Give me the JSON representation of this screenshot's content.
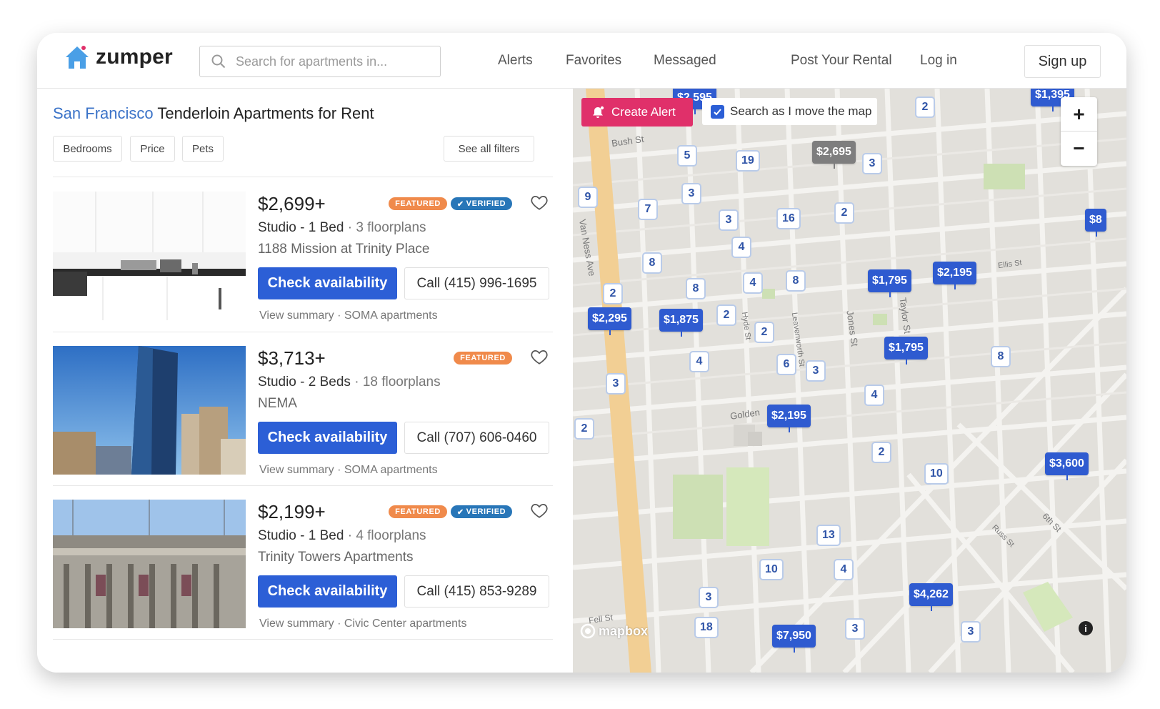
{
  "brand": {
    "name": "zumper"
  },
  "search": {
    "placeholder": "Search for apartments in..."
  },
  "nav": {
    "alerts": "Alerts",
    "favorites": "Favorites",
    "messaged": "Messaged",
    "post": "Post Your Rental",
    "login": "Log in",
    "signup": "Sign up"
  },
  "page": {
    "city": "San Francisco",
    "title_rest": " Tenderloin Apartments for Rent"
  },
  "filters": {
    "bedrooms": "Bedrooms",
    "price": "Price",
    "pets": "Pets",
    "all": "See all filters"
  },
  "badges": {
    "featured": "FEATURED",
    "verified": "VERIFIED"
  },
  "listings": [
    {
      "price": "$2,699+",
      "beds": "Studio - 1 Bed",
      "sep": " · ",
      "floorplans": "3 floorplans",
      "name": "1188 Mission at Trinity Place",
      "cta": "Check availability",
      "call": "Call (415) 996-1695",
      "view": "View summary",
      "dot": " · ",
      "area": "SOMA apartments",
      "featured": true,
      "verified": true
    },
    {
      "price": "$3,713+",
      "beds": "Studio - 2 Beds",
      "sep": " · ",
      "floorplans": "18 floorplans",
      "name": "NEMA",
      "cta": "Check availability",
      "call": "Call (707) 606-0460",
      "view": "View summary",
      "dot": " · ",
      "area": "SOMA apartments",
      "featured": true,
      "verified": false
    },
    {
      "price": "$2,199+",
      "beds": "Studio - 1 Bed",
      "sep": " · ",
      "floorplans": "4 floorplans",
      "name": "Trinity Towers Apartments",
      "cta": "Check availability",
      "call": "Call (415) 853-9289",
      "view": "View summary",
      "dot": " · ",
      "area": "Civic Center apartments",
      "featured": true,
      "verified": true
    }
  ],
  "map": {
    "create_alert": "Create Alert",
    "search_move": "Search as I move the map",
    "zoom_in": "+",
    "zoom_out": "−",
    "attribution": "mapbox",
    "info": "i",
    "streets": {
      "bush": "Bush St",
      "ellis": "Ellis St",
      "golden": "Golden",
      "van_ness": "Van Ness Ave",
      "hyde": "Hyde St",
      "leavenworth": "Leavenworth St",
      "jones": "Jones St",
      "taylor": "Taylor St",
      "russ": "Russ St",
      "sixth": "6th St",
      "fell": "Fell St"
    },
    "count_pins": [
      "2",
      "5",
      "19",
      "3",
      "9",
      "3",
      "7",
      "3",
      "16",
      "2",
      "8",
      "4",
      "4",
      "8",
      "8",
      "2",
      "2",
      "2",
      "4",
      "6",
      "3",
      "8",
      "3",
      "4",
      "2",
      "2",
      "10",
      "13",
      "10",
      "4",
      "3",
      "18",
      "3",
      "3"
    ],
    "price_pins": [
      "$2,695",
      "$1,795",
      "$2,195",
      "$2,295",
      "$1,875",
      "$1,795",
      "$2,195",
      "$3,600",
      "$4,262",
      "$7,950",
      "$1,395",
      "$2,595",
      "$8"
    ]
  },
  "colors": {
    "primary": "#2c5fd6",
    "alert": "#e0306a",
    "featured": "#f08a4b",
    "verified": "#2876b8",
    "link": "#3b73c8"
  }
}
